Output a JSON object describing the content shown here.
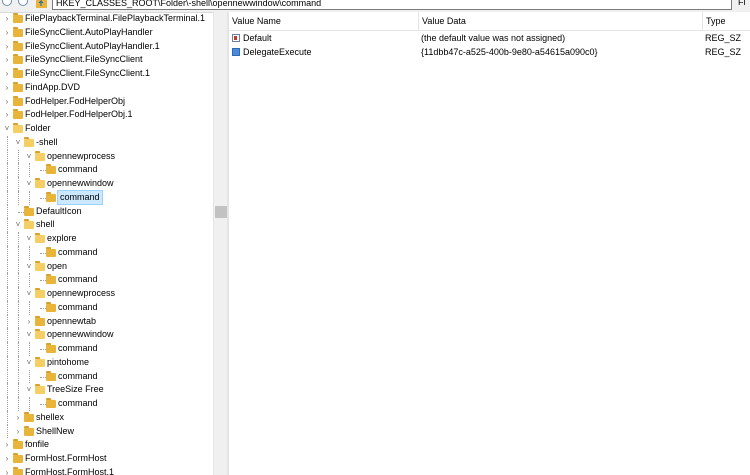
{
  "address_bar": {
    "path": "HKEY_CLASSES_ROOT\\Folder\\-shell\\opennewwindow\\command",
    "corner_text": "Fi"
  },
  "icons": {
    "back": "back-arrow-icon",
    "forward": "forward-arrow-icon",
    "up": "folder-up-icon",
    "folder": "folder-icon",
    "expanded": "chevron-down-icon",
    "collapsed": "chevron-right-icon",
    "string_value": "reg-sz-icon"
  },
  "colors": {
    "folder": "#e8b53a",
    "selection": "#cce8ff",
    "selection_border": "#99d1ff"
  },
  "tree": {
    "items": [
      {
        "label": "FilePlaybackTerminal.FilePlaybackTerminal.1",
        "level": 0,
        "expander": "collapsed"
      },
      {
        "label": "FileSyncClient.AutoPlayHandler",
        "level": 0,
        "expander": "collapsed"
      },
      {
        "label": "FileSyncClient.AutoPlayHandler.1",
        "level": 0,
        "expander": "collapsed"
      },
      {
        "label": "FileSyncClient.FileSyncClient",
        "level": 0,
        "expander": "collapsed"
      },
      {
        "label": "FileSyncClient.FileSyncClient.1",
        "level": 0,
        "expander": "collapsed"
      },
      {
        "label": "FindApp.DVD",
        "level": 0,
        "expander": "collapsed"
      },
      {
        "label": "FodHelper.FodHelperObj",
        "level": 0,
        "expander": "collapsed"
      },
      {
        "label": "FodHelper.FodHelperObj.1",
        "level": 0,
        "expander": "collapsed"
      },
      {
        "label": "Folder",
        "level": 0,
        "expander": "expanded",
        "open": true
      },
      {
        "label": "-shell",
        "level": 1,
        "expander": "expanded",
        "open": true
      },
      {
        "label": "opennewprocess",
        "level": 2,
        "expander": "expanded",
        "open": true
      },
      {
        "label": "command",
        "level": 3,
        "expander": "none"
      },
      {
        "label": "opennewwindow",
        "level": 2,
        "expander": "expanded",
        "open": true
      },
      {
        "label": "command",
        "level": 3,
        "expander": "none",
        "selected": true
      },
      {
        "label": "DefaultIcon",
        "level": 1,
        "expander": "none"
      },
      {
        "label": "shell",
        "level": 1,
        "expander": "expanded",
        "open": true
      },
      {
        "label": "explore",
        "level": 2,
        "expander": "expanded",
        "open": true
      },
      {
        "label": "command",
        "level": 3,
        "expander": "none"
      },
      {
        "label": "open",
        "level": 2,
        "expander": "expanded",
        "open": true
      },
      {
        "label": "command",
        "level": 3,
        "expander": "none"
      },
      {
        "label": "opennewprocess",
        "level": 2,
        "expander": "expanded",
        "open": true
      },
      {
        "label": "command",
        "level": 3,
        "expander": "none"
      },
      {
        "label": "opennewtab",
        "level": 2,
        "expander": "collapsed"
      },
      {
        "label": "opennewwindow",
        "level": 2,
        "expander": "expanded",
        "open": true
      },
      {
        "label": "command",
        "level": 3,
        "expander": "none"
      },
      {
        "label": "pintohome",
        "level": 2,
        "expander": "expanded",
        "open": true
      },
      {
        "label": "command",
        "level": 3,
        "expander": "none"
      },
      {
        "label": "TreeSize Free",
        "level": 2,
        "expander": "expanded",
        "open": true
      },
      {
        "label": "command",
        "level": 3,
        "expander": "none"
      },
      {
        "label": "shellex",
        "level": 1,
        "expander": "collapsed"
      },
      {
        "label": "ShellNew",
        "level": 1,
        "expander": "collapsed"
      },
      {
        "label": "fonfile",
        "level": 0,
        "expander": "collapsed"
      },
      {
        "label": "FormHost.FormHost",
        "level": 0,
        "expander": "collapsed"
      },
      {
        "label": "FormHost.FormHost.1",
        "level": 0,
        "expander": "collapsed"
      }
    ]
  },
  "values_pane": {
    "columns": {
      "name": "Value Name",
      "data": "Value Data",
      "type": "Type"
    },
    "rows": [
      {
        "name": "Default",
        "data": "(the default value was not assigned)",
        "type": "REG_SZ",
        "icon": "string"
      },
      {
        "name": "DelegateExecute",
        "data": "{11dbb47c-a525-400b-9e80-a54615a090c0}",
        "type": "REG_SZ",
        "icon": "binary"
      }
    ]
  }
}
